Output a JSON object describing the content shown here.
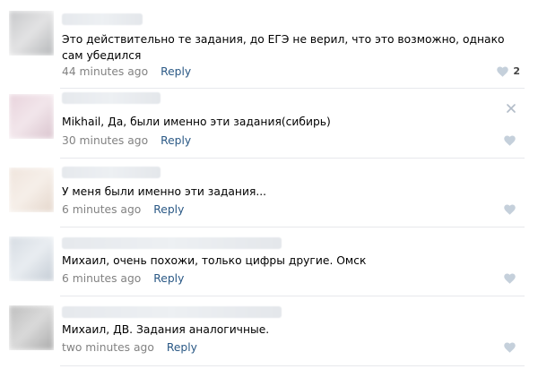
{
  "comments": [
    {
      "text": "Это действительно те задания, до ЕГЭ не верил, что это возможно, однако сам убедился",
      "time": "44 minutes ago",
      "reply_label": "Reply",
      "like_count": "2",
      "avatar_colors": [
        "#c6c7c9",
        "#e3e3e4",
        "#b4b6b8"
      ]
    },
    {
      "text": "Mikhail, Да, были именно эти задания(сибирь)",
      "time": "30 minutes ago",
      "reply_label": "Reply",
      "like_count": "",
      "avatar_colors": [
        "#e8d3dc",
        "#f2e6eb",
        "#d9c3cd"
      ]
    },
    {
      "text": "У меня были именно эти задания...",
      "time": "6 minutes ago",
      "reply_label": "Reply",
      "like_count": "",
      "avatar_colors": [
        "#efe4dc",
        "#f6efe9",
        "#e4d6cb"
      ]
    },
    {
      "text": "Михаил, очень похожи, только цифры другие. Омск",
      "time": "6 minutes ago",
      "reply_label": "Reply",
      "like_count": "",
      "avatar_colors": [
        "#d5dbe2",
        "#e9edf1",
        "#c3cbd4"
      ]
    },
    {
      "text": "Михаил, ДВ. Задания аналогичные.",
      "time": "two minutes ago",
      "reply_label": "Reply",
      "like_count": "",
      "avatar_colors": [
        "#bdbdbd",
        "#dadada",
        "#a9a9a9"
      ]
    }
  ],
  "colors": {
    "link": "#2a5885",
    "muted": "#828282",
    "icon": "#c5d0db",
    "divider": "#e7e8ec"
  }
}
